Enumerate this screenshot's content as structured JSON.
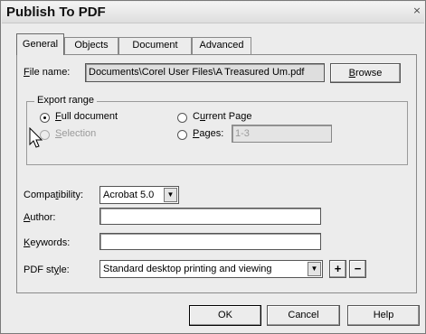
{
  "window": {
    "title": "Publish To PDF",
    "close_glyph": "×"
  },
  "tabs": [
    {
      "label": "General",
      "active": true
    },
    {
      "label": "Objects",
      "active": false
    },
    {
      "label": "Document",
      "active": false
    },
    {
      "label": "Advanced",
      "active": false
    }
  ],
  "file": {
    "label_prefix": "",
    "label_underline": "F",
    "label_rest": "ile name:",
    "value": "Documents\\Corel User Files\\A Treasured Um.pdf",
    "browse_label_underline": "B",
    "browse_label_rest": "rowse"
  },
  "export_range": {
    "title": "Export range",
    "options": {
      "full_document": {
        "underline": "F",
        "rest": "ull document",
        "checked": true
      },
      "current_page": {
        "prefix": "C",
        "underline": "u",
        "rest": "rrent Page",
        "checked": false
      },
      "selection": {
        "underline": "S",
        "rest": "election",
        "disabled": true
      },
      "pages": {
        "underline": "P",
        "rest": "ages:",
        "value": "1-3"
      }
    }
  },
  "compatibility": {
    "prefix": "Compa",
    "underline": "t",
    "rest": "ibility:",
    "value": "Acrobat 5.0"
  },
  "author": {
    "underline": "A",
    "rest": "uthor:",
    "value": ""
  },
  "keywords": {
    "underline": "K",
    "rest": "eywords:",
    "value": ""
  },
  "pdf_style": {
    "prefix": "PDF st",
    "underline": "y",
    "rest": "le:",
    "value": "Standard desktop printing and viewing",
    "add_label": "+",
    "remove_label": "−"
  },
  "footer": {
    "ok_label": "OK",
    "cancel_label": "Cancel",
    "help_label": "Help"
  },
  "icons": [
    "close-icon",
    "dropdown-arrow-icon",
    "mouse-pointer-icon"
  ]
}
